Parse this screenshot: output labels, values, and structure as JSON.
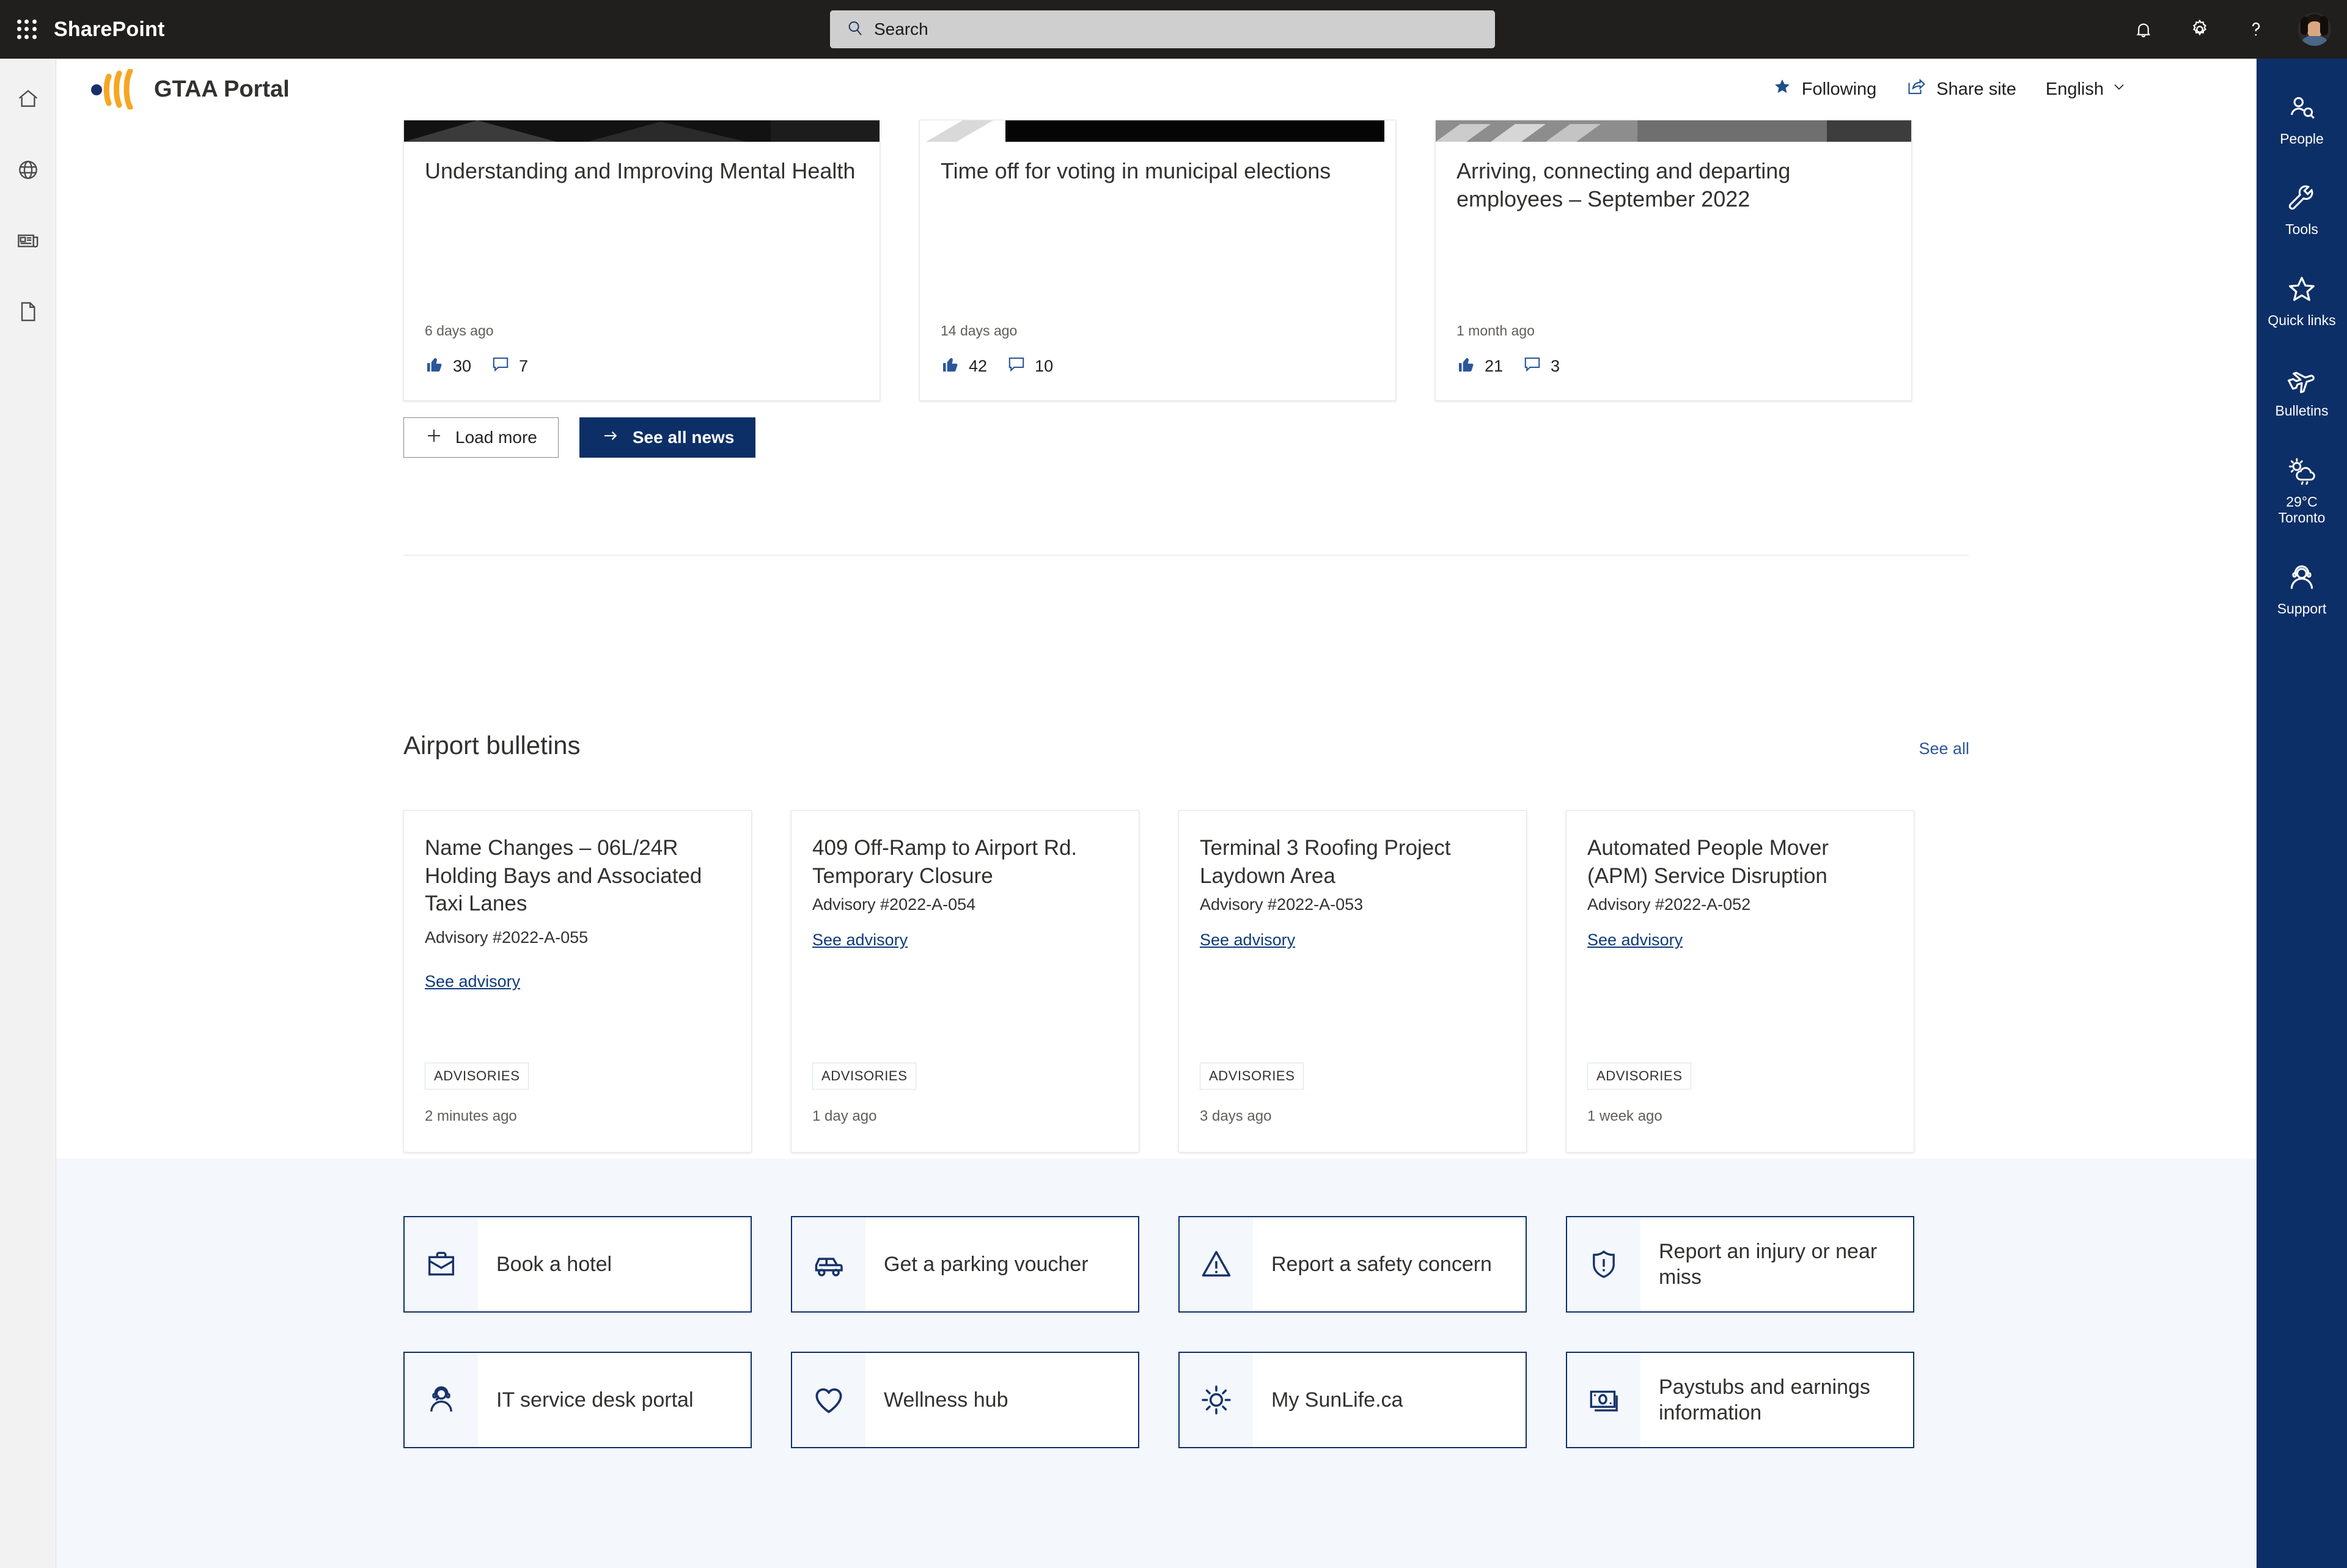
{
  "suite": {
    "app_name": "SharePoint",
    "search_placeholder": "Search",
    "icons": {
      "waffle": "app-launcher-icon",
      "search": "search-icon",
      "notifications": "bell-icon",
      "settings": "gear-icon",
      "help": "question-mark-icon",
      "account": "avatar"
    }
  },
  "left_rail": {
    "items": [
      {
        "icon": "home-icon"
      },
      {
        "icon": "globe-icon"
      },
      {
        "icon": "news-icon"
      },
      {
        "icon": "document-icon"
      }
    ]
  },
  "site_header": {
    "title": "GTAA Portal",
    "following_label": "Following",
    "share_label": "Share site",
    "language_label": "English"
  },
  "news": {
    "cards": [
      {
        "title": "Understanding and Improving Mental Health",
        "date": "6 days ago",
        "likes": "30",
        "comments": "7"
      },
      {
        "title": "Time off for voting in municipal elections",
        "date": "14 days ago",
        "likes": "42",
        "comments": "10"
      },
      {
        "title": "Arriving, connecting and departing employees – September 2022",
        "date": "1 month ago",
        "likes": "21",
        "comments": "3"
      }
    ],
    "load_more_label": "Load more",
    "see_all_label": "See all news"
  },
  "bulletins": {
    "section_title": "Airport bulletins",
    "see_all_label": "See all",
    "cards": [
      {
        "title": "Name Changes – 06L/24R Holding Bays and Associated Taxi Lanes",
        "advisory": "Advisory #2022-A-055",
        "link": "See advisory",
        "tag": "ADVISORIES",
        "date": "2 minutes ago"
      },
      {
        "title": "409 Off-Ramp to Airport Rd. Temporary Closure",
        "advisory": "Advisory #2022-A-054",
        "link": "See advisory",
        "tag": "ADVISORIES",
        "date": "1 day ago"
      },
      {
        "title": "Terminal 3 Roofing Project Laydown Area",
        "advisory": "Advisory #2022-A-053",
        "link": "See advisory",
        "tag": "ADVISORIES",
        "date": "3 days ago"
      },
      {
        "title": "Automated People Mover (APM) Service Disruption",
        "advisory": "Advisory #2022-A-052",
        "link": "See advisory",
        "tag": "ADVISORIES",
        "date": "1 week ago"
      }
    ]
  },
  "quick_links": {
    "tiles": [
      {
        "label": "Book a hotel",
        "icon": "briefcase-icon"
      },
      {
        "label": "Get a parking voucher",
        "icon": "car-icon"
      },
      {
        "label": "Report a safety concern",
        "icon": "warning-triangle-icon"
      },
      {
        "label": "Report an injury or near miss",
        "icon": "shield-alert-icon"
      },
      {
        "label": "IT service desk portal",
        "icon": "headset-person-icon"
      },
      {
        "label": "Wellness hub",
        "icon": "heart-icon"
      },
      {
        "label": "My SunLife.ca",
        "icon": "sun-icon"
      },
      {
        "label": "Paystubs and earnings information",
        "icon": "banknote-icon"
      }
    ]
  },
  "right_rail": {
    "items": [
      {
        "label": "People",
        "icon": "person-search-icon"
      },
      {
        "label": "Tools",
        "icon": "wrench-icon"
      },
      {
        "label": "Quick links",
        "icon": "star-outline-icon"
      },
      {
        "label": "Bulletins",
        "icon": "airplane-icon"
      },
      {
        "label": "29°C\nToronto",
        "icon": "weather-sun-rain-icon"
      },
      {
        "label": "Support",
        "icon": "headset-person-icon"
      }
    ],
    "weather_temp": "29°C",
    "weather_city": "Toronto"
  },
  "colors": {
    "brand_navy": "#0d2f67",
    "brand_gold": "#f5a623",
    "suite_bar": "#201f1e",
    "band_bg": "#f4f7fb",
    "link": "#2b579a"
  }
}
